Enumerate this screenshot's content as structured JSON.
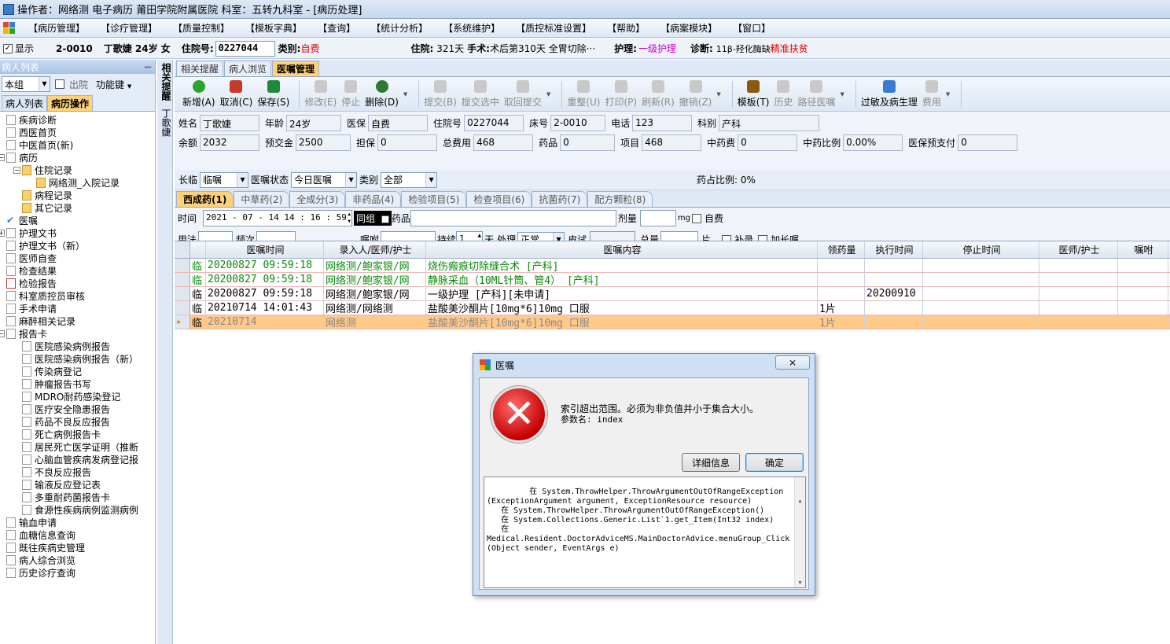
{
  "window": {
    "title": "操作者：网络测 电子病历  莆田学院附属医院  科室：五转九科室 - [病历处理]"
  },
  "menu": [
    "【病历管理】",
    "【诊疗管理】",
    "【质量控制】",
    "【模板字典】",
    "【查询】",
    "【统计分析】",
    "【系统维护】",
    "【质控标准设置】",
    "【帮助】",
    "【病案模块】",
    "【窗口】"
  ],
  "patient_bar": {
    "show_label": "显示",
    "bed": "2-0010",
    "name_age_sex": "丁歌婕 24岁 女",
    "admission_label": "住院号:",
    "admission_no": "0227044",
    "type_label": "类别:",
    "type_value": "自费",
    "stay_label": "住院:",
    "stay_value": "321天",
    "surgery_label": "手术:",
    "surgery_value": "术后第310天  全胃切除···",
    "nursing_label": "护理:",
    "nursing_value": "一级护理",
    "diagnosis_label": "诊断:",
    "diagnosis_value": "11β-羟化酶缺",
    "poverty_tag": "精准扶贫"
  },
  "left_panel": {
    "title": "病人列表",
    "pin": "ᅲ",
    "group_combo": "本组",
    "discharged_label": "出院",
    "func_key_label": "功能键",
    "tabs": [
      "病人列表",
      "病历操作"
    ],
    "tree": [
      {
        "label": "疾病诊断",
        "level": 1,
        "expander": ""
      },
      {
        "label": "西医首页",
        "level": 1,
        "expander": ""
      },
      {
        "label": "中医首页(新)",
        "level": 1,
        "expander": ""
      },
      {
        "label": "病历",
        "level": 1,
        "expander": "−"
      },
      {
        "label": "住院记录",
        "level": 2,
        "expander": "−"
      },
      {
        "label": "网络测_入院记录",
        "level": 3,
        "expander": ""
      },
      {
        "label": "病程记录",
        "level": 2,
        "expander": ""
      },
      {
        "label": "其它记录",
        "level": 2,
        "expander": ""
      },
      {
        "label": "医嘱",
        "level": 1,
        "expander": ""
      },
      {
        "label": "护理文书",
        "level": 1,
        "expander": "+"
      },
      {
        "label": "护理文书（新）",
        "level": 1,
        "expander": ""
      },
      {
        "label": "医师自查",
        "level": 1,
        "expander": ""
      },
      {
        "label": "检查结果",
        "level": 1,
        "expander": ""
      },
      {
        "label": "检验报告",
        "level": 1,
        "expander": ""
      },
      {
        "label": "科室质控员审核",
        "level": 1,
        "expander": ""
      },
      {
        "label": "手术申请",
        "level": 1,
        "expander": ""
      },
      {
        "label": "麻醉相关记录",
        "level": 1,
        "expander": ""
      },
      {
        "label": "报告卡",
        "level": 1,
        "expander": "−"
      },
      {
        "label": "医院感染病例报告",
        "level": 2,
        "expander": ""
      },
      {
        "label": "医院感染病例报告（新）",
        "level": 2,
        "expander": ""
      },
      {
        "label": "传染病登记",
        "level": 2,
        "expander": ""
      },
      {
        "label": "肿瘤报告书写",
        "level": 2,
        "expander": ""
      },
      {
        "label": "MDRO耐药感染登记",
        "level": 2,
        "expander": ""
      },
      {
        "label": "医疗安全隐患报告",
        "level": 2,
        "expander": ""
      },
      {
        "label": "药品不良反应报告",
        "level": 2,
        "expander": ""
      },
      {
        "label": "死亡病例报告卡",
        "level": 2,
        "expander": ""
      },
      {
        "label": "居民死亡医学证明（推断",
        "level": 2,
        "expander": ""
      },
      {
        "label": "心脑血管疾病发病登记报",
        "level": 2,
        "expander": ""
      },
      {
        "label": "不良反应报告",
        "level": 2,
        "expander": ""
      },
      {
        "label": "输液反应登记表",
        "level": 2,
        "expander": ""
      },
      {
        "label": "多重耐药菌报告卡",
        "level": 2,
        "expander": ""
      },
      {
        "label": "食源性疾病病例监测病例",
        "level": 2,
        "expander": ""
      },
      {
        "label": "输血申请",
        "level": 1,
        "expander": ""
      },
      {
        "label": "血糖信息查询",
        "level": 1,
        "expander": ""
      },
      {
        "label": "既往疾病史管理",
        "level": 1,
        "expander": ""
      },
      {
        "label": "病人综合浏览",
        "level": 1,
        "expander": ""
      },
      {
        "label": "历史诊疗查询",
        "level": 1,
        "expander": ""
      }
    ]
  },
  "vstrip": {
    "label": "相关提醒",
    "name": "丁歌婕"
  },
  "main_tabs": [
    "相关提醒",
    "病人浏览",
    "医嘱管理"
  ],
  "toolbar": [
    {
      "label": "新增(A)",
      "enabled": true,
      "color": "#2aa52a"
    },
    {
      "label": "取消(C)",
      "enabled": true,
      "color": "#c43b2e"
    },
    {
      "label": "保存(S)",
      "enabled": true,
      "color": "#1e8a3a"
    },
    {
      "label": "修改(E)",
      "enabled": false,
      "color": ""
    },
    {
      "label": "停止",
      "enabled": false,
      "color": ""
    },
    {
      "label": "删除(D)",
      "enabled": true,
      "color": "#2f7a2f"
    },
    {
      "label": "提交(B)",
      "enabled": false,
      "color": ""
    },
    {
      "label": "提交选中",
      "enabled": false,
      "color": ""
    },
    {
      "label": "取回提交",
      "enabled": false,
      "color": ""
    },
    {
      "label": "重整(U)",
      "enabled": false,
      "color": ""
    },
    {
      "label": "打印(P)",
      "enabled": false,
      "color": ""
    },
    {
      "label": "刷新(R)",
      "enabled": false,
      "color": ""
    },
    {
      "label": "撤销(Z)",
      "enabled": false,
      "color": ""
    },
    {
      "label": "模板(T)",
      "enabled": true,
      "color": "#8a5a10"
    },
    {
      "label": "历史",
      "enabled": false,
      "color": ""
    },
    {
      "label": "路径医嘱",
      "enabled": false,
      "color": ""
    },
    {
      "label": "过敏及病生理",
      "enabled": true,
      "color": "#3a7bd5"
    },
    {
      "label": "费用",
      "enabled": false,
      "color": ""
    }
  ],
  "form": {
    "row1": [
      {
        "label": "姓名",
        "value": "丁歌婕"
      },
      {
        "label": "年龄",
        "value": "24岁"
      },
      {
        "label": "医保",
        "value": "自费"
      },
      {
        "label": "住院号",
        "value": "0227044"
      },
      {
        "label": "床号",
        "value": "2-0010"
      },
      {
        "label": "电话",
        "value": "123"
      },
      {
        "label": "科别",
        "value": "产科"
      }
    ],
    "row2": [
      {
        "label": "余额",
        "value": "2032"
      },
      {
        "label": "预交金",
        "value": "2500"
      },
      {
        "label": "担保",
        "value": "0"
      },
      {
        "label": "总费用",
        "value": "468"
      },
      {
        "label": "药品",
        "value": "0"
      },
      {
        "label": "项目",
        "value": "468"
      },
      {
        "label": "中药费",
        "value": "0"
      },
      {
        "label": "中药比例",
        "value": "0.00%"
      },
      {
        "label": "医保预支付",
        "value": "0"
      }
    ]
  },
  "filter": {
    "long_label": "长临",
    "long_value": "临嘱",
    "status_label": "医嘱状态",
    "status_value": "今日医嘱",
    "category_label": "类别",
    "category_value": "全部",
    "ratio": "药占比例: 0%"
  },
  "drug_tabs": [
    "西成药(1)",
    "中草药(2)",
    "全成分(3)",
    "非药品(4)",
    "检验项目(5)",
    "检查项目(6)",
    "抗菌药(7)",
    "配方颗粒(8)"
  ],
  "entry": {
    "time_label": "时间",
    "time_value": "2021 - 07 - 14   14 : 16 : 59",
    "group_label": "同组",
    "drug_label": "药品",
    "dose_label": "剂量",
    "dose_unit": "mg",
    "selfpay_label": "自费",
    "usage_label": "用法",
    "freq_label": "频次",
    "advice_label": "嘱咐",
    "duration_label": "持续",
    "duration_value": "1",
    "day_label": "天",
    "handle_label": "处理",
    "handle_value": "正常",
    "skin_label": "皮试",
    "total_label": "总量",
    "total_unit": "片",
    "supplement_label": "补录",
    "extend_label": "加长嘱"
  },
  "grid": {
    "headers": [
      "医嘱时间",
      "录入人/医师/护士",
      "医嘱内容",
      "领药量",
      "执行时间",
      "停止时间",
      "医师/护士",
      "嘱咐"
    ],
    "rows": [
      {
        "flag": "临",
        "time": "20200827 09:59:18",
        "by": "网络测/鲍家银/网",
        "content": "烧伤瘢痕切除缝合术   [产科]",
        "qty": "",
        "exec": "",
        "stop": "",
        "doc": "",
        "note": "",
        "style": "green",
        "marker": ""
      },
      {
        "flag": "临",
        "time": "20200827 09:59:18",
        "by": "网络测/鲍家银/网",
        "content": "静脉采血（10ML针筒、管4）   [产科]",
        "qty": "",
        "exec": "",
        "stop": "",
        "doc": "",
        "note": "",
        "style": "green",
        "marker": ""
      },
      {
        "flag": "临",
        "time": "20200827 09:59:18",
        "by": "网络测/鲍家银/网",
        "content": "一级护理    [产科][未申请]",
        "qty": "",
        "exec": "20200910",
        "stop": "",
        "doc": "",
        "note": "",
        "style": "black",
        "marker": ""
      },
      {
        "flag": "临",
        "time": "20210714 14:01:43",
        "by": "网络测/网络测",
        "content": "盐酸美沙酮片[10mg*6]10mg  口服",
        "qty": "1片",
        "exec": "",
        "stop": "",
        "doc": "",
        "note": "",
        "style": "black",
        "marker": ""
      },
      {
        "flag": "临",
        "time": "20210714",
        "by": "网络测",
        "content": "盐酸美沙酮片[10mg*6]10mg  口服",
        "qty": "1片",
        "exec": "",
        "stop": "",
        "doc": "",
        "note": "",
        "style": "sel",
        "marker": "▸"
      }
    ]
  },
  "dialog": {
    "title": "医嘱",
    "close": "⨯",
    "icon": "✕",
    "message_line1": "索引超出范围。必须为非负值并小于集合大小。",
    "message_line2": "参数名: index",
    "details_button": "详细信息",
    "ok_button": "确定",
    "trace": "   在 System.ThrowHelper.ThrowArgumentOutOfRangeException\n(ExceptionArgument argument, ExceptionResource resource)\n   在 System.ThrowHelper.ThrowArgumentOutOfRangeException()\n   在 System.Collections.Generic.List`1.get_Item(Int32 index)\n   在\nMedical.Resident.DoctorAdviceMS.MainDoctorAdvice.menuGroup_Click\n(Object sender, EventArgs e)"
  }
}
